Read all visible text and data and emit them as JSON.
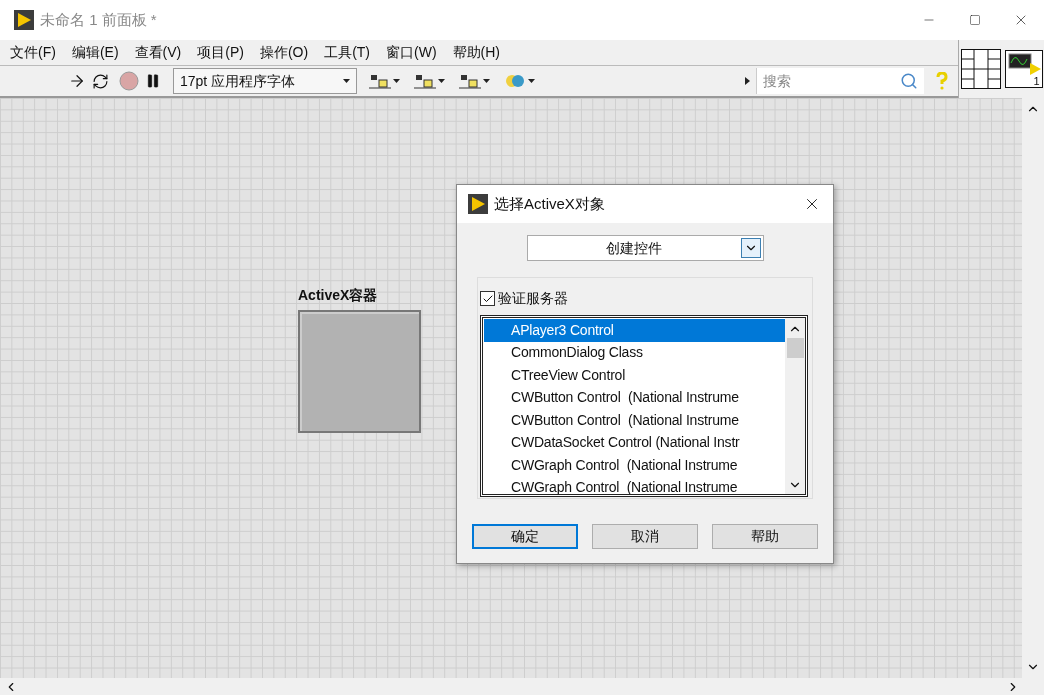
{
  "window": {
    "title": "未命名 1 前面板 *"
  },
  "menu": [
    "文件(F)",
    "编辑(E)",
    "查看(V)",
    "项目(P)",
    "操作(O)",
    "工具(T)",
    "窗口(W)",
    "帮助(H)"
  ],
  "toolbar": {
    "font": "17pt 应用程序字体",
    "search": {
      "placeholder": "搜索"
    }
  },
  "connector_pane": {
    "terminal": "1"
  },
  "canvas": {
    "container": {
      "label": "ActiveX容器"
    }
  },
  "dialog": {
    "title": "选择ActiveX对象",
    "mode": "创建控件",
    "validate": {
      "label": "验证服务器",
      "checked": true
    },
    "items": [
      {
        "label": "APlayer3 Control",
        "selected": true
      },
      {
        "label": "CommonDialog Class",
        "selected": false
      },
      {
        "label": "CTreeView Control",
        "selected": false
      },
      {
        "label": "CWButton Control  (National Instrume",
        "selected": false
      },
      {
        "label": "CWButton Control  (National Instrume",
        "selected": false
      },
      {
        "label": "CWDataSocket Control (National Instr",
        "selected": false
      },
      {
        "label": "CWGraph Control  (National Instrume",
        "selected": false
      },
      {
        "label": "CWGraph Control  (National Instrume",
        "selected": false
      }
    ],
    "buttons": [
      {
        "label": "确定",
        "default": true
      },
      {
        "label": "取消",
        "default": false
      },
      {
        "label": "帮助",
        "default": false
      }
    ]
  }
}
